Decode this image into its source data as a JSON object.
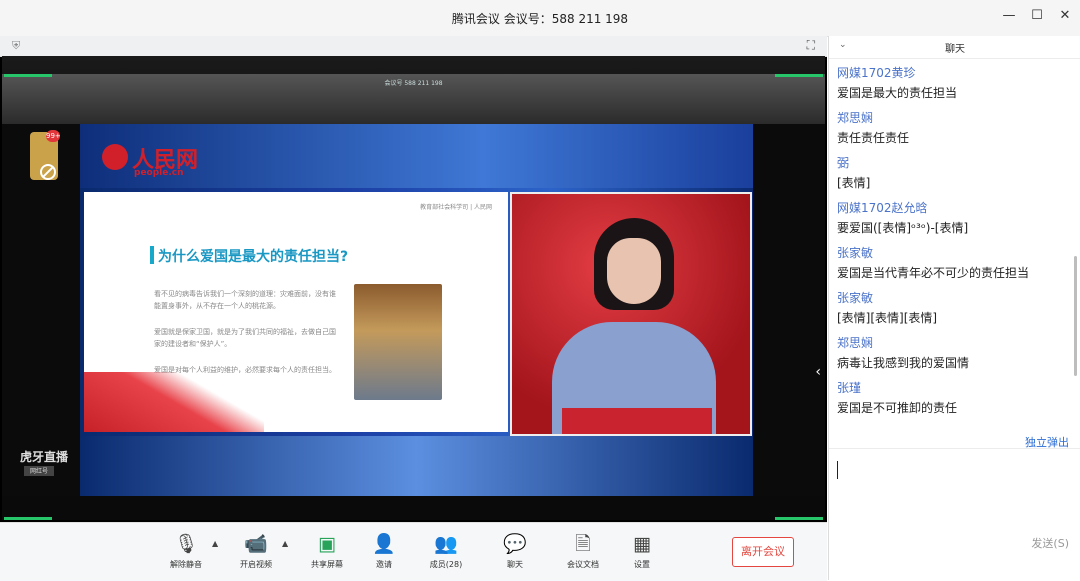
{
  "window": {
    "title": "腾讯会议 会议号：588 211 198",
    "controls": {
      "minimize": "—",
      "maximize": "☐",
      "close": "✕"
    }
  },
  "stage": {
    "fullscreen_icon": "⛶",
    "shield_icon": "⛨",
    "mini_meeting_id": "会议号 588 211 198",
    "badge_count": "99+",
    "broadcaster_label": "虎牙直播",
    "broadcaster_tag": "网红号",
    "next_arrow": "‹"
  },
  "broadcast": {
    "logo_text": "人民网",
    "logo_sub": "people.cn",
    "slide": {
      "header": "教育部社会科学司 | 人民网",
      "title": "为什么爱国是最大的责任担当?",
      "bullets": [
        "看不见的病毒告诉我们一个深刻的道理：灾难面前，没有谁能置身事外，从不存在一个人的桃花源。",
        "爱国就是保家卫国，就是为了我们共同的福祉，去做自己国家的建设者和“保护人”。",
        "爱国是对每个人利益的维护，必然要求每个人的责任担当。"
      ]
    }
  },
  "toolbar": {
    "unmute": "解除静音",
    "start_video": "开启视频",
    "share_screen": "共享屏幕",
    "invite": "邀请",
    "members": "成员(28)",
    "chat": "聊天",
    "docs": "会议文档",
    "settings": "设置",
    "leave": "离开会议",
    "caret": "▲"
  },
  "chat": {
    "title": "聊天",
    "collapse_icon": "⌄",
    "messages": [
      {
        "sender": "网媒1702黄珍",
        "text": "爱国是最大的责任担当"
      },
      {
        "sender": "郑思娴",
        "text": "责任责任责任"
      },
      {
        "sender": "弼",
        "text": "[表情]"
      },
      {
        "sender": "网媒1702赵允晗",
        "text": "要爱国([表情]ᵒ³ᵒ)-[表情]"
      },
      {
        "sender": "张家敏",
        "text": "爱国是当代青年必不可少的责任担当"
      },
      {
        "sender": "张家敏",
        "text": "[表情][表情][表情]"
      },
      {
        "sender": "郑思娴",
        "text": "病毒让我感到我的爱国情"
      },
      {
        "sender": "张瑾",
        "text": "爱国是不可推卸的责任"
      }
    ],
    "popout": "独立弹出",
    "input_value": "",
    "send": "发送(S)"
  }
}
